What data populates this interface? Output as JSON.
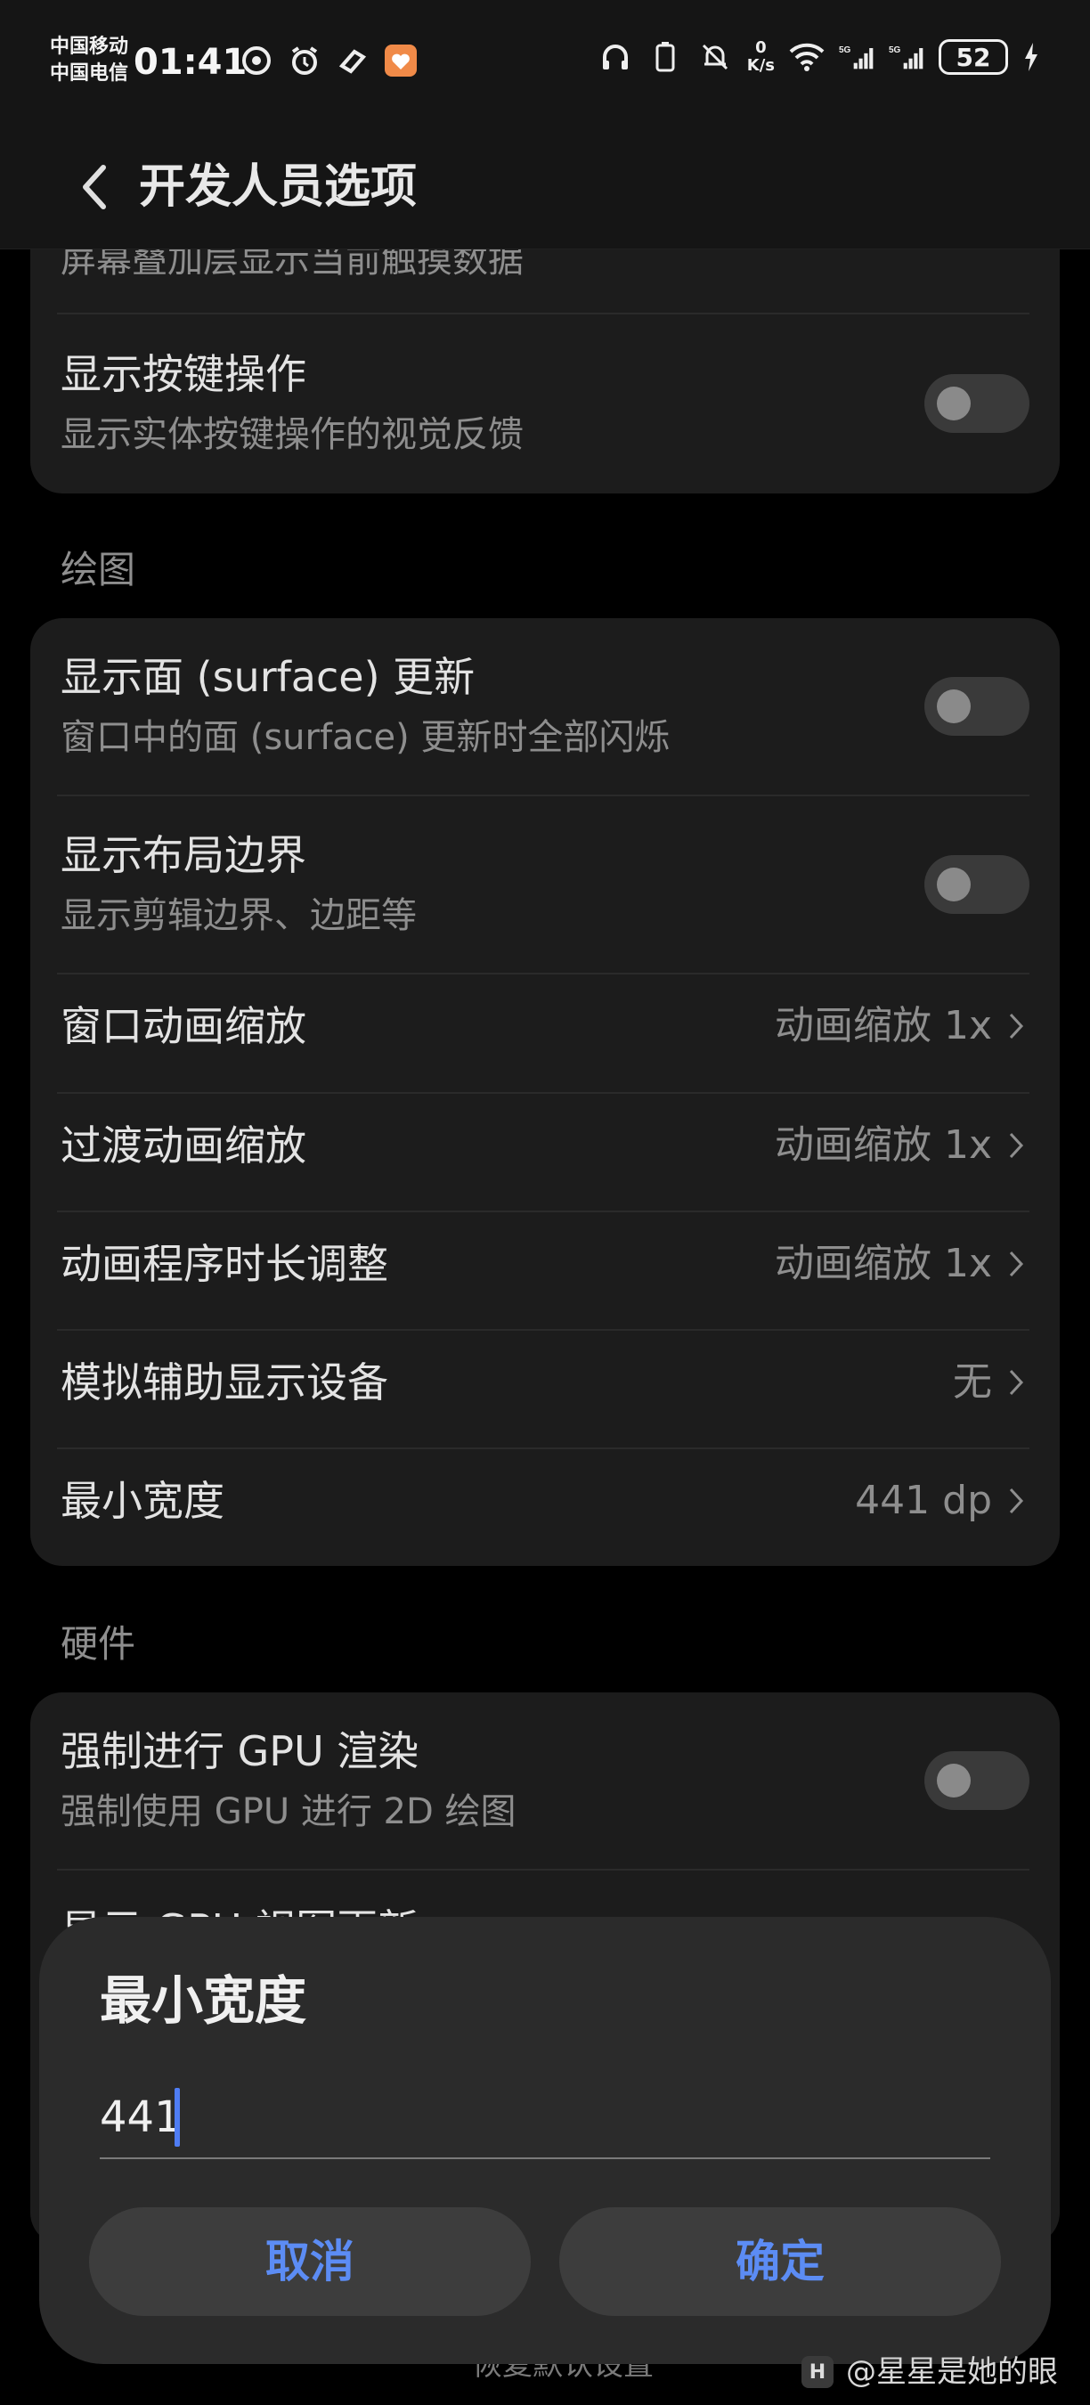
{
  "status_bar": {
    "carrier_1": "中国移动",
    "carrier_2": "中国电信",
    "time": "01:41",
    "net_speed_value": "0",
    "net_speed_unit": "K/s",
    "battery": "52"
  },
  "header": {
    "title": "开发人员选项"
  },
  "top_card": {
    "partial_sub": "屏幕叠加层显示当前触摸数据",
    "show_key_title": "显示按键操作",
    "show_key_sub": "显示实体按键操作的视觉反馈"
  },
  "drawing_section": {
    "label": "绘图",
    "items": [
      {
        "title": "显示面 (surface) 更新",
        "sub": "窗口中的面 (surface) 更新时全部闪烁"
      },
      {
        "title": "显示布局边界",
        "sub": "显示剪辑边界、边距等"
      },
      {
        "title": "窗口动画缩放",
        "value": "动画缩放 1x"
      },
      {
        "title": "过渡动画缩放",
        "value": "动画缩放 1x"
      },
      {
        "title": "动画程序时长调整",
        "value": "动画缩放 1x"
      },
      {
        "title": "模拟辅助显示设备",
        "value": "无"
      },
      {
        "title": "最小宽度",
        "value": "441 dp"
      }
    ]
  },
  "hardware_section": {
    "label": "硬件",
    "gpu_title": "强制进行 GPU 渲染",
    "gpu_sub": "强制使用 GPU 进行 2D 绘图",
    "partial_title": "显示 GPU 视图更新"
  },
  "dialog": {
    "title": "最小宽度",
    "input_value": "441",
    "cancel": "取消",
    "confirm": "确定"
  },
  "bottom_hint": "恢复默认设置",
  "watermark": {
    "logo": "H",
    "text": "@星星是她的眼"
  },
  "colors": {
    "accent": "#5c8cf4",
    "card": "#1c1c1c",
    "dialog": "#2b2b2b"
  }
}
